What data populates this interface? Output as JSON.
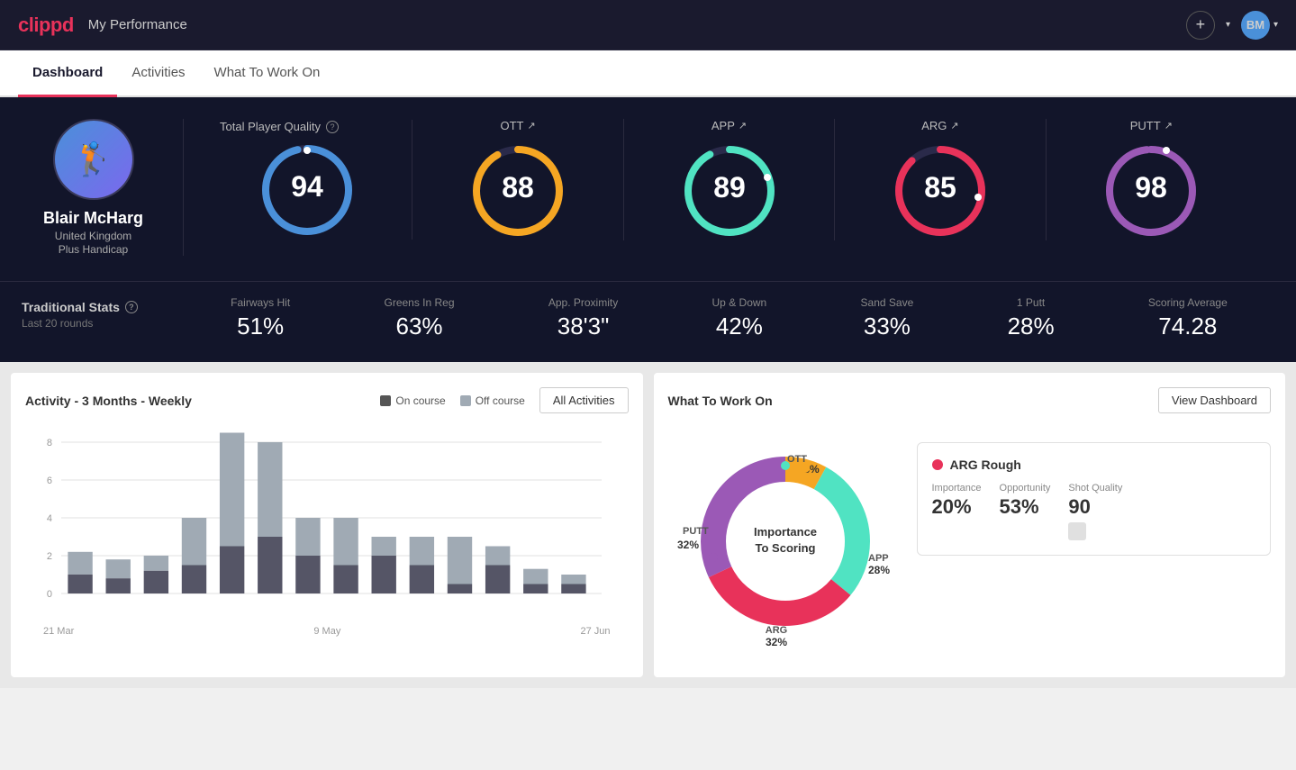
{
  "header": {
    "logo": "clippd",
    "title": "My Performance",
    "add_icon": "+",
    "avatar_initials": "BM"
  },
  "tabs": [
    {
      "id": "dashboard",
      "label": "Dashboard",
      "active": true
    },
    {
      "id": "activities",
      "label": "Activities",
      "active": false
    },
    {
      "id": "what-to-work-on",
      "label": "What To Work On",
      "active": false
    }
  ],
  "player": {
    "name": "Blair McHarg",
    "country": "United Kingdom",
    "handicap": "Plus Handicap"
  },
  "scores": {
    "total_quality_label": "Total Player Quality",
    "total": {
      "value": "94",
      "color": "#4a90d9"
    },
    "ott": {
      "label": "OTT",
      "value": "88",
      "color": "#f5a623"
    },
    "app": {
      "label": "APP",
      "value": "89",
      "color": "#50e3c2"
    },
    "arg": {
      "label": "ARG",
      "value": "85",
      "color": "#e8325a"
    },
    "putt": {
      "label": "PUTT",
      "value": "98",
      "color": "#9b59b6"
    }
  },
  "traditional_stats": {
    "title": "Traditional Stats",
    "subtitle": "Last 20 rounds",
    "stats": [
      {
        "name": "Fairways Hit",
        "value": "51%"
      },
      {
        "name": "Greens In Reg",
        "value": "63%"
      },
      {
        "name": "App. Proximity",
        "value": "38'3\""
      },
      {
        "name": "Up & Down",
        "value": "42%"
      },
      {
        "name": "Sand Save",
        "value": "33%"
      },
      {
        "name": "1 Putt",
        "value": "28%"
      },
      {
        "name": "Scoring Average",
        "value": "74.28"
      }
    ]
  },
  "activity_chart": {
    "title": "Activity - 3 Months - Weekly",
    "on_course_label": "On course",
    "off_course_label": "Off course",
    "all_activities_btn": "All Activities",
    "x_labels": [
      "21 Mar",
      "9 May",
      "27 Jun"
    ],
    "bars": [
      {
        "on": 1,
        "off": 1.2
      },
      {
        "on": 0.8,
        "off": 1.0
      },
      {
        "on": 1.2,
        "off": 0.8
      },
      {
        "on": 1.5,
        "off": 2.5
      },
      {
        "on": 2.5,
        "off": 6
      },
      {
        "on": 3,
        "off": 5
      },
      {
        "on": 2,
        "off": 2
      },
      {
        "on": 1.5,
        "off": 2.5
      },
      {
        "on": 2,
        "off": 1
      },
      {
        "on": 1.5,
        "off": 1.5
      },
      {
        "on": 0.5,
        "off": 2.5
      },
      {
        "on": 1.5,
        "off": 1
      },
      {
        "on": 0.5,
        "off": 0.8
      },
      {
        "on": 0.5,
        "off": 0.5
      }
    ],
    "y_labels": [
      "0",
      "2",
      "4",
      "6",
      "8"
    ]
  },
  "what_to_work_on": {
    "title": "What To Work On",
    "view_dashboard_btn": "View Dashboard",
    "center_label_line1": "Importance",
    "center_label_line2": "To Scoring",
    "segments": [
      {
        "label": "OTT",
        "pct": "8%",
        "color": "#f5a623",
        "value": 8
      },
      {
        "label": "APP",
        "pct": "28%",
        "color": "#50e3c2",
        "value": 28
      },
      {
        "label": "ARG",
        "pct": "32%",
        "color": "#e8325a",
        "value": 32
      },
      {
        "label": "PUTT",
        "pct": "32%",
        "color": "#9b59b6",
        "value": 32
      }
    ],
    "info_card": {
      "title": "ARG Rough",
      "dot_color": "#e8325a",
      "metrics": [
        {
          "name": "Importance",
          "value": "20%"
        },
        {
          "name": "Opportunity",
          "value": "53%"
        },
        {
          "name": "Shot Quality",
          "value": "90"
        }
      ]
    }
  },
  "colors": {
    "dark_bg": "#12152a",
    "panel_bg": "#fff",
    "accent": "#e8325a",
    "ott": "#f5a623",
    "app": "#50e3c2",
    "arg": "#e8325a",
    "putt": "#9b59b6",
    "total": "#4a90d9"
  }
}
